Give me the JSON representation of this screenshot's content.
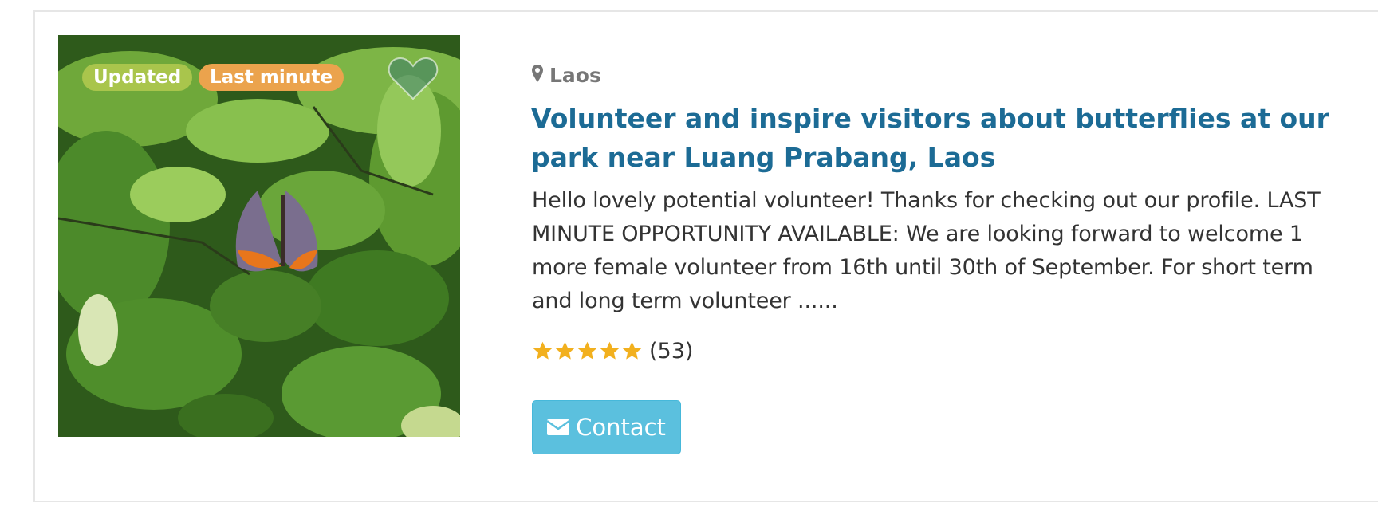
{
  "badges": {
    "updated": "Updated",
    "last_minute": "Last minute"
  },
  "listing": {
    "location": "Laos",
    "title": "Volunteer and inspire visitors about butterflies at our park near Luang Prabang, Laos",
    "description": "Hello lovely potential volunteer! Thanks for checking out our profile. LAST MINUTE OPPORTUNITY AVAILABLE: We are looking forward to welcome 1 more female volunteer from 16th until 30th of September. For short term and long term volunteer ......",
    "rating": {
      "stars": 5,
      "max": 5,
      "count_label": "(53)"
    },
    "contact_label": "Contact"
  },
  "icons": {
    "location": "map-marker-icon",
    "favorite": "heart-icon",
    "contact": "envelope-icon",
    "star": "star-icon"
  },
  "colors": {
    "title": "#1c6b95",
    "updated_badge": "#a9c54c",
    "last_minute_badge": "#eba34d",
    "star": "#f2b01e",
    "contact_button": "#5bc0de",
    "location_text": "#777777"
  }
}
